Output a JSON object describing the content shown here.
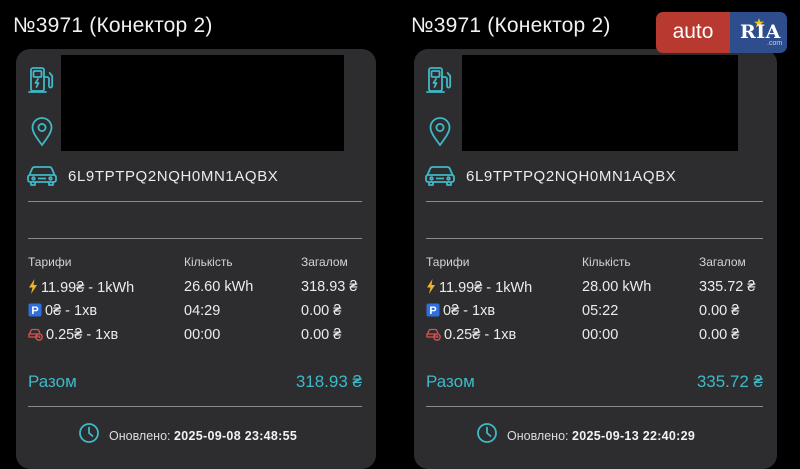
{
  "colors": {
    "background": "#000000",
    "card": "#2d2d2f",
    "accent": "#3fb8c8",
    "text": "#ececec",
    "divider": "#8a8a8c",
    "lightning": "#f2b32c",
    "parking": "#2f6fe0",
    "idle": "#d9534f",
    "logo_auto": "#b8392f",
    "logo_ria": "#2d4d8c"
  },
  "logo": {
    "auto": "auto",
    "ria": "RIA",
    "com": ".com"
  },
  "left": {
    "title": "№3971 (Конектор 2)",
    "vin": "6L9TPTPQ2NQH0MN1AQBX",
    "headers": {
      "tariffs": "Тарифи",
      "quantity": "Кількість",
      "total": "Загалом"
    },
    "rows": [
      {
        "icon": "lightning-icon",
        "tariff": "11.99₴ - 1kWh",
        "quantity": "26.60 kWh",
        "total": "318.93 ₴"
      },
      {
        "icon": "parking-icon",
        "tariff": "0₴ - 1хв",
        "quantity": "04:29",
        "total": "0.00 ₴"
      },
      {
        "icon": "idle-car-icon",
        "tariff": "0.25₴ - 1хв",
        "quantity": "00:00",
        "total": "0.00 ₴"
      }
    ],
    "sum_label": "Разом",
    "sum_value": "318.93 ₴",
    "updated_label": "Оновлено:",
    "updated_value": "2025-09-08 23:48:55"
  },
  "right": {
    "title": "№3971 (Конектор 2)",
    "vin": "6L9TPTPQ2NQH0MN1AQBX",
    "headers": {
      "tariffs": "Тарифи",
      "quantity": "Кількість",
      "total": "Загалом"
    },
    "rows": [
      {
        "icon": "lightning-icon",
        "tariff": "11.99₴ - 1kWh",
        "quantity": "28.00 kWh",
        "total": "335.72 ₴"
      },
      {
        "icon": "parking-icon",
        "tariff": "0₴ - 1хв",
        "quantity": "05:22",
        "total": "0.00 ₴"
      },
      {
        "icon": "idle-car-icon",
        "tariff": "0.25₴ - 1хв",
        "quantity": "00:00",
        "total": "0.00 ₴"
      }
    ],
    "sum_label": "Разом",
    "sum_value": "335.72 ₴",
    "updated_label": "Оновлено:",
    "updated_value": "2025-09-13 22:40:29"
  }
}
